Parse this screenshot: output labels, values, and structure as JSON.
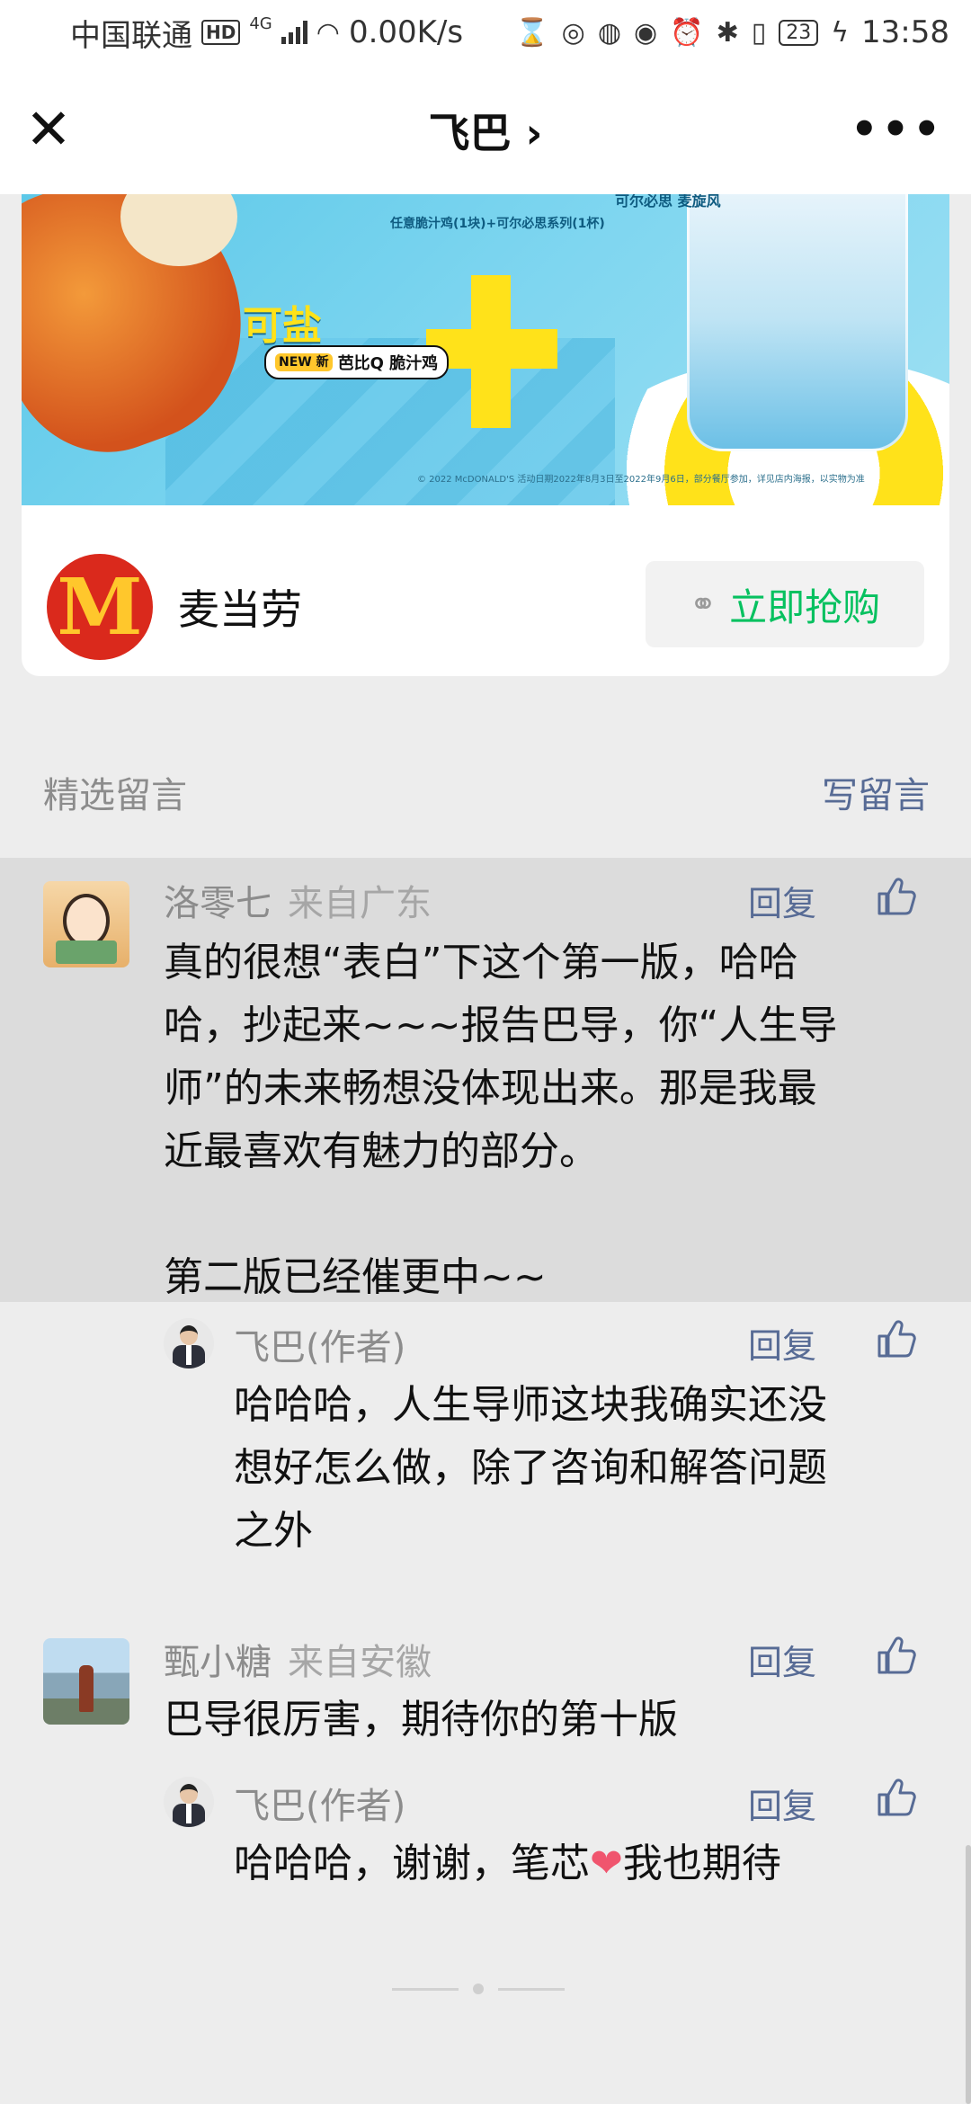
{
  "status_bar": {
    "carrier": "中国联通",
    "hd": "HD",
    "network": "4G",
    "speed": "0.00K/s",
    "battery": "23",
    "time": "13:58"
  },
  "nav": {
    "title": "飞巴 ›"
  },
  "ad": {
    "headline_fragment": "可盐",
    "badge_new": "NEW 新",
    "badge_text": "芭比Q 脆汁鸡",
    "small_line": "任意脆汁鸡(1块)+可尔必思系列(1杯)",
    "tag_text": "可尔必思 麦旋风",
    "fine_print": "© 2022 McDONALD'S 活动日期2022年8月3日至2022年9月6日，部分餐厅参加，详见店内海报，以实物为准",
    "brand_name": "麦当劳",
    "brand_logo": "M",
    "buy_label": "立即抢购",
    "link_icon": "link-icon"
  },
  "comments_header": {
    "title": "精选留言",
    "write": "写留言"
  },
  "comments": [
    {
      "name": "洛零七",
      "from": "来自广东",
      "reply": "回复",
      "text": "真的很想“表白”下这个第一版，哈哈\n哈，抄起来~~~报告巴导，你“人生导\n师”的未来畅想没体现出来。那是我最\n近最喜欢有魅力的部分。\n\n第二版已经催更中~~",
      "author_reply": {
        "name": "飞巴(作者)",
        "reply": "回复",
        "text": "哈哈哈，人生导师这块我确实还没\n想好怎么做，除了咨询和解答问题\n之外"
      }
    },
    {
      "name": "甄小糖",
      "from": "来自安徽",
      "reply": "回复",
      "text": "巴导很厉害，期待你的第十版",
      "author_reply": {
        "name": "飞巴(作者)",
        "reply": "回复",
        "text_before": "哈哈哈，谢谢，笔芯",
        "heart": "❤",
        "text_after": "我也期待"
      }
    }
  ],
  "colors": {
    "link_blue": "#576b95",
    "wechat_green": "#07c160",
    "highlight_bg": "#dcdcdc",
    "page_bg": "#ededed"
  }
}
